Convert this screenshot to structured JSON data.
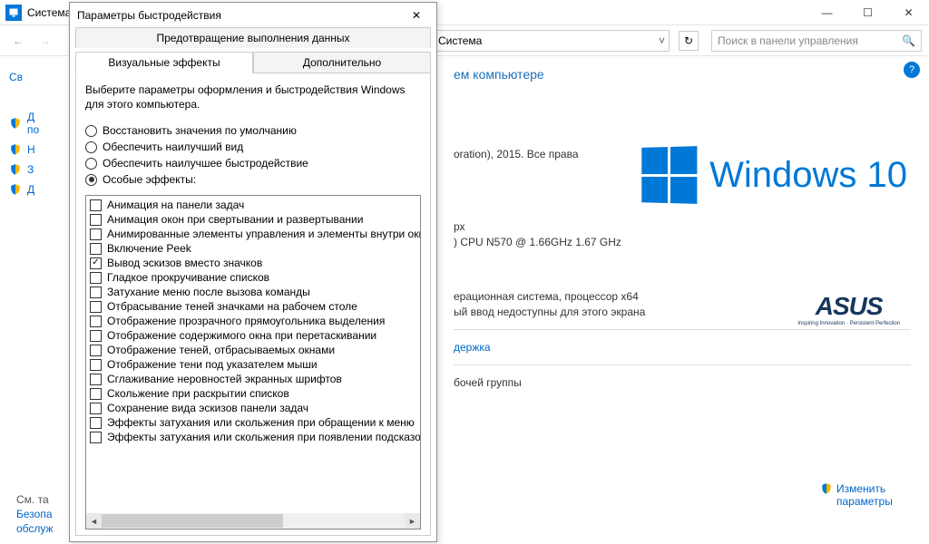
{
  "window": {
    "title": "Система"
  },
  "breadcrumb": {
    "text": "Система"
  },
  "search": {
    "placeholder": "Поиск в панели управления"
  },
  "sidebar": {
    "items": [
      {
        "label": "Св"
      },
      {
        "label": "Д",
        "sub": "по"
      },
      {
        "label": "Н"
      },
      {
        "label": "З"
      },
      {
        "label": "Д"
      }
    ],
    "footer_label": "См. та",
    "footer_links": [
      "Безопа",
      "обслуж"
    ]
  },
  "main": {
    "heading_suffix": "ем компьютере",
    "copyright": "oration), 2015. Все права",
    "cpu_line1": "рх",
    "cpu_line2": ") CPU N570   @ 1.66GHz   1.67 GHz",
    "os_line": "ерационная система, процессор x64",
    "touch_line": "ый ввод недоступны для этого экрана",
    "support_link": "держка",
    "workgroup_line": "бочей группы",
    "change_link": "Изменить параметры",
    "win10_text": "Windows 10",
    "asus_brand": "ASUS",
    "asus_tag": "Inspiring Innovation · Persistent Perfection"
  },
  "dialog": {
    "title": "Параметры быстродействия",
    "tab_top": "Предотвращение выполнения данных",
    "tab1": "Визуальные эффекты",
    "tab2": "Дополнительно",
    "desc": "Выберите параметры оформления и быстродействия Windows для этого компьютера.",
    "radios": [
      "Восстановить значения по умолчанию",
      "Обеспечить наилучший вид",
      "Обеспечить наилучшее быстродействие",
      "Особые эффекты:"
    ],
    "checked_radio": 3,
    "checks": [
      {
        "label": "Анимация на панели задач",
        "checked": false
      },
      {
        "label": "Анимация окон при свертывании и развертывании",
        "checked": false
      },
      {
        "label": "Анимированные элементы управления и элементы внутри окн",
        "checked": false
      },
      {
        "label": "Включение Peek",
        "checked": false
      },
      {
        "label": "Вывод эскизов вместо значков",
        "checked": true
      },
      {
        "label": "Гладкое прокручивание списков",
        "checked": false
      },
      {
        "label": "Затухание меню после вызова команды",
        "checked": false
      },
      {
        "label": "Отбрасывание теней значками на рабочем столе",
        "checked": false
      },
      {
        "label": "Отображение прозрачного прямоугольника выделения",
        "checked": false
      },
      {
        "label": "Отображение содержимого окна при перетаскивании",
        "checked": false
      },
      {
        "label": "Отображение теней, отбрасываемых окнами",
        "checked": false
      },
      {
        "label": "Отображение тени под указателем мыши",
        "checked": false
      },
      {
        "label": "Сглаживание неровностей экранных шрифтов",
        "checked": false
      },
      {
        "label": "Скольжение при раскрытии списков",
        "checked": false
      },
      {
        "label": "Сохранение вида эскизов панели задач",
        "checked": false
      },
      {
        "label": "Эффекты затухания или скольжения при обращении к меню",
        "checked": false
      },
      {
        "label": "Эффекты затухания или скольжения при появлении подсказок",
        "checked": false
      }
    ]
  }
}
